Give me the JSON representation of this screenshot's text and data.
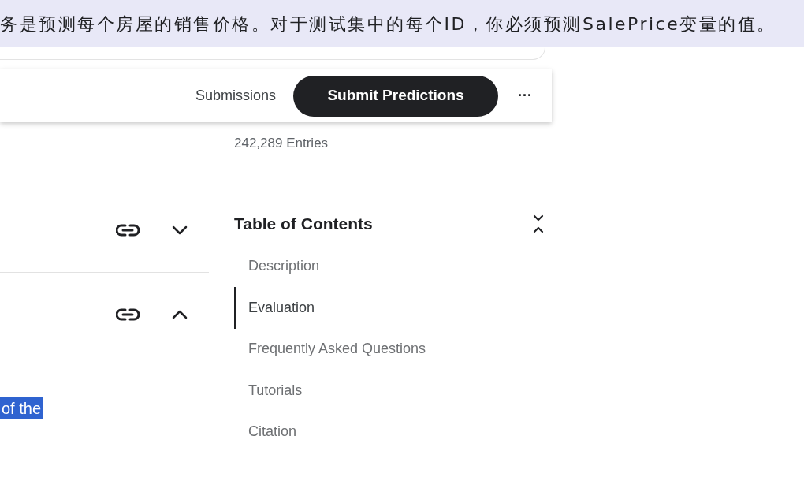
{
  "banner": {
    "text": "务是预测每个房屋的销售价格。对于测试集中的每个ID，你必须预测SalePrice变量的值。"
  },
  "toolbar": {
    "submissions": "Submissions",
    "submit_button": "Submit Predictions",
    "more": "···"
  },
  "stats": {
    "entries": "242,289 Entries"
  },
  "sections": [
    {
      "expanded": false
    },
    {
      "expanded": true
    }
  ],
  "selected_text": "of the",
  "table_of_contents": {
    "title": "Table of Contents",
    "items": [
      {
        "label": "Description",
        "selected": false
      },
      {
        "label": "Evaluation",
        "selected": true
      },
      {
        "label": "Frequently Asked Questions",
        "selected": false
      },
      {
        "label": "Tutorials",
        "selected": false
      },
      {
        "label": "Citation",
        "selected": false
      }
    ]
  }
}
